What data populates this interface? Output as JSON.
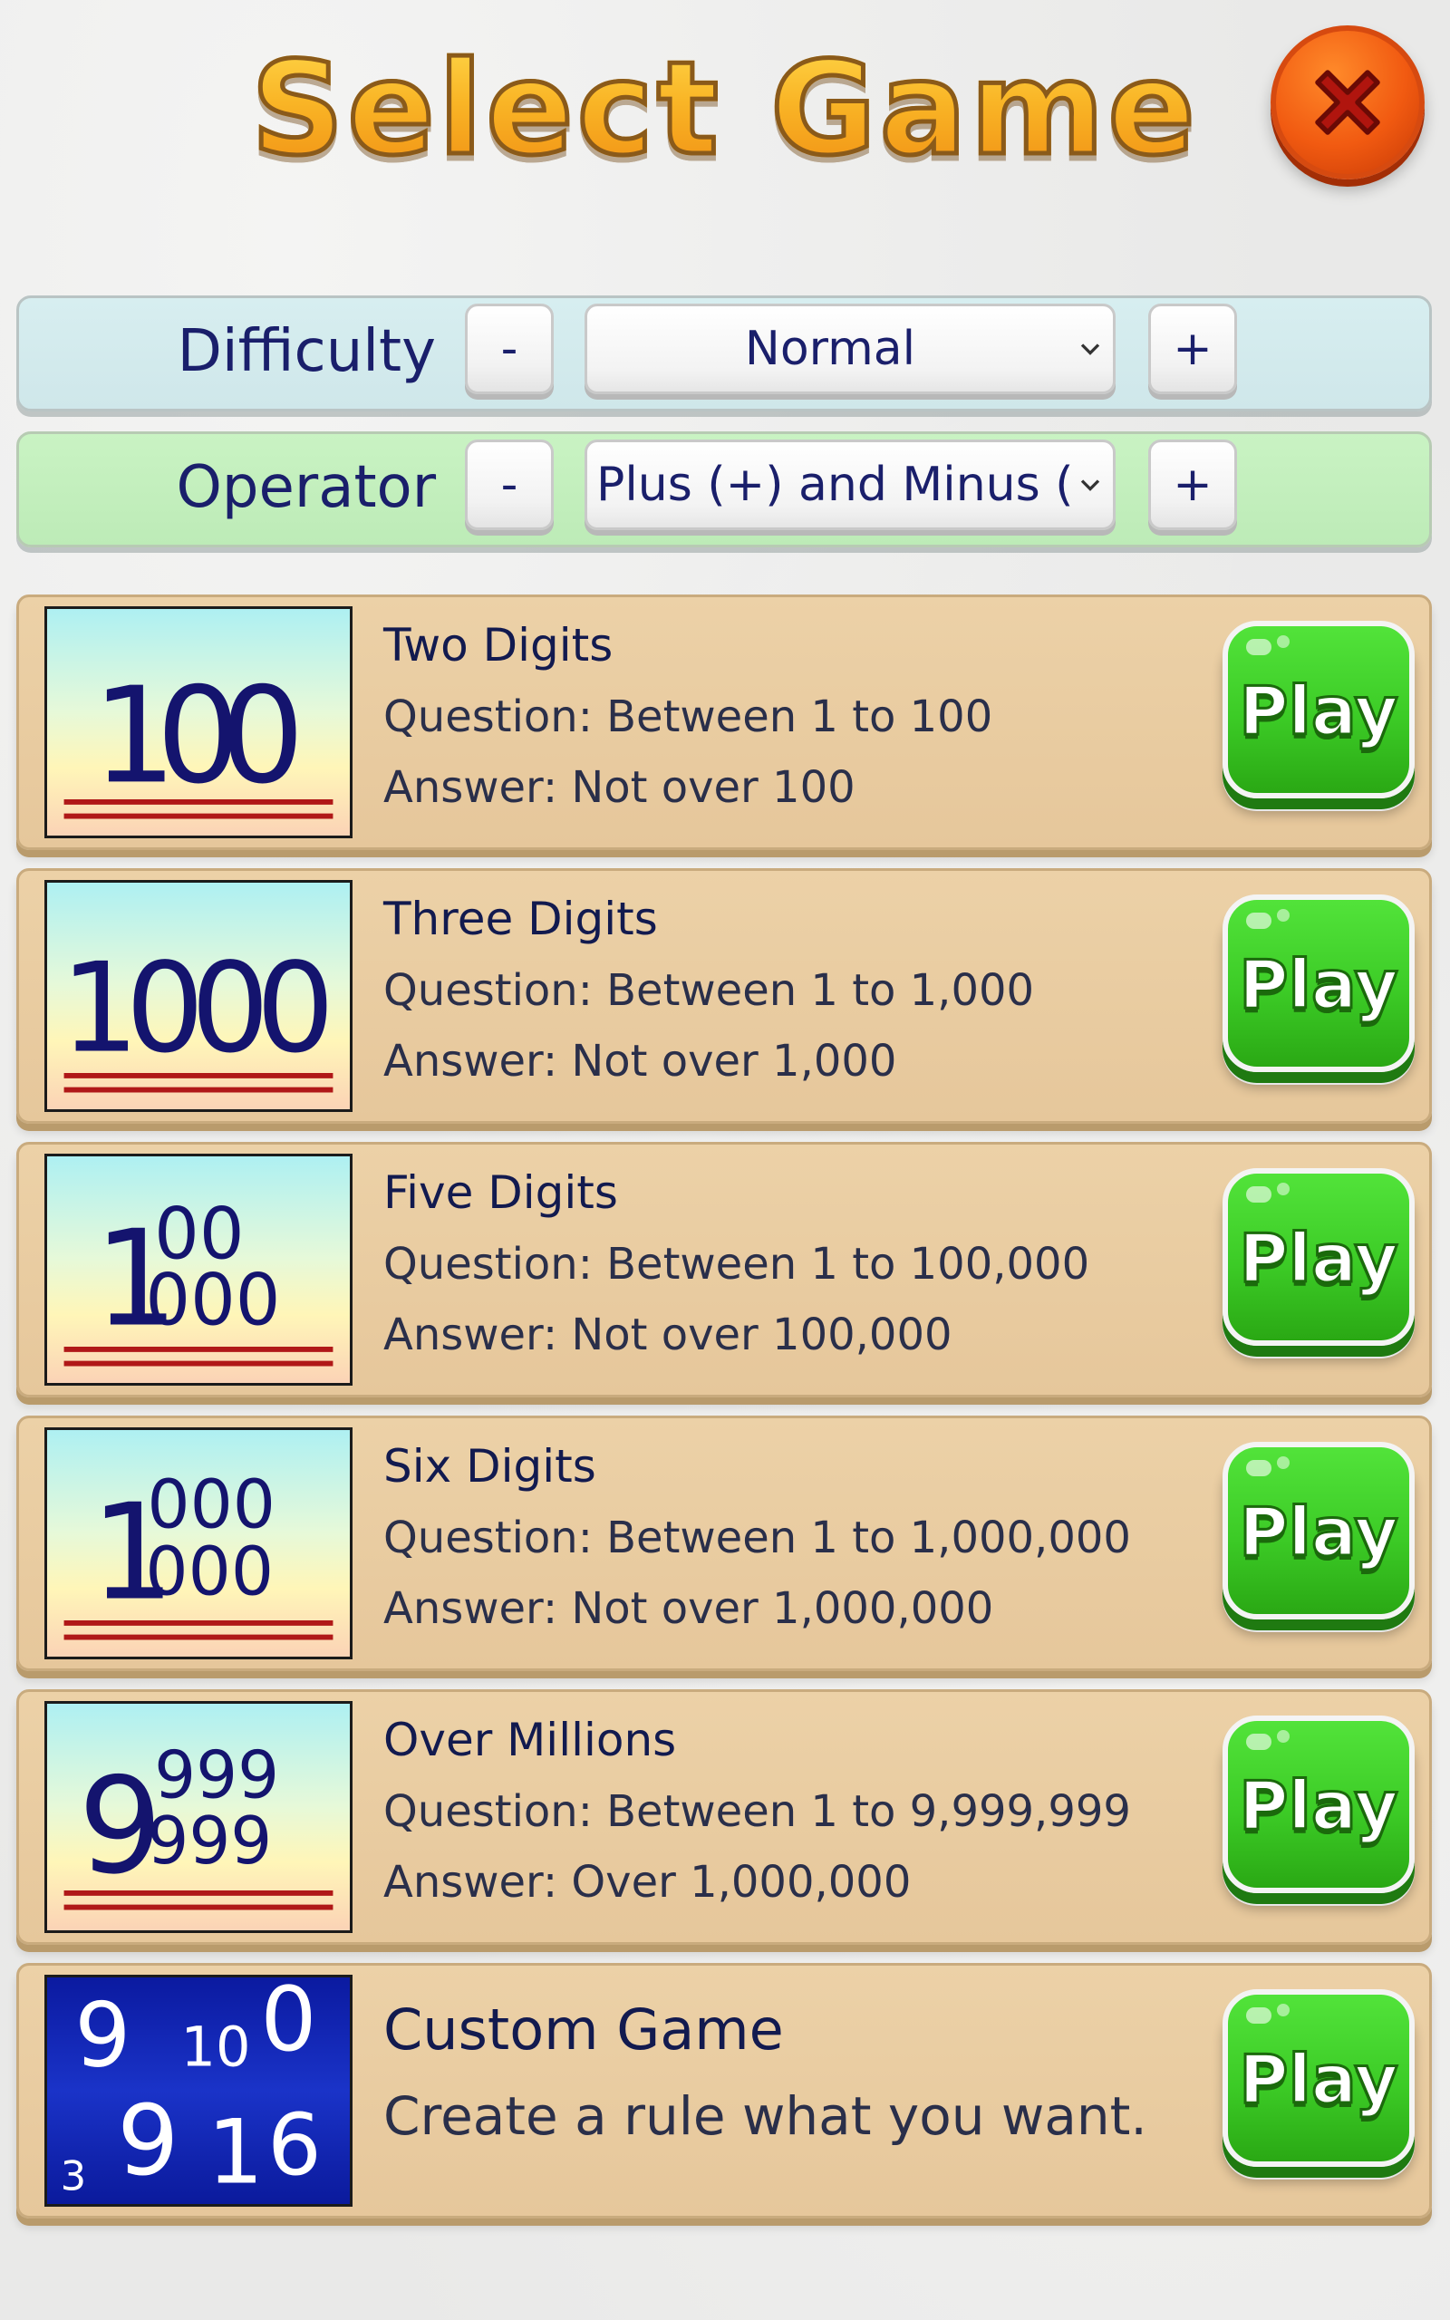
{
  "header": {
    "title": "Select Game"
  },
  "colors": {
    "title": "#f7a51a",
    "close": "#f15a11",
    "play": "#3ccb26",
    "text": "#1a1f6b",
    "card": "#e8cba0"
  },
  "settings": {
    "difficulty": {
      "label": "Difficulty",
      "minus": "-",
      "plus": "+",
      "value": "Normal"
    },
    "operator": {
      "label": "Operator",
      "minus": "-",
      "plus": "+",
      "value": "Plus (+) and Minus (-)"
    }
  },
  "games": [
    {
      "thumb": "100",
      "title": "Two Digits",
      "line1": "Question: Between 1 to 100",
      "line2": "Answer: Not over 100",
      "button": "Play"
    },
    {
      "thumb": "1000",
      "title": "Three Digits",
      "line1": "Question: Between 1 to 1,000",
      "line2": "Answer: Not over 1,000",
      "button": "Play"
    },
    {
      "thumb": "100000",
      "title": "Five Digits",
      "line1": "Question: Between 1 to 100,000",
      "line2": "Answer: Not over 100,000",
      "button": "Play"
    },
    {
      "thumb": "1000000",
      "title": "Six Digits",
      "line1": "Question: Between 1 to 1,000,000",
      "line2": "Answer: Not over 1,000,000",
      "button": "Play"
    },
    {
      "thumb": "9999999",
      "title": "Over Millions",
      "line1": "Question: Between 1 to 9,999,999",
      "line2": "Answer: Over 1,000,000",
      "button": "Play"
    },
    {
      "thumb": "custom",
      "title": "Custom Game",
      "line1": "Create a rule what you want.",
      "button": "Play"
    }
  ],
  "thumbs": {
    "two": {
      "main": "100"
    },
    "three": {
      "main": "1000"
    },
    "five": {
      "lead": "1",
      "top": "00",
      "bottom": "000"
    },
    "six": {
      "lead": "1",
      "top": "000",
      "bottom": "000"
    },
    "millions": {
      "lead": "9",
      "top": "999",
      "bottom": "999"
    },
    "custom": {
      "a": "9",
      "b": "10",
      "c": "0",
      "d": "3",
      "e": "9",
      "f": "1",
      "g": "6"
    }
  },
  "icons": {
    "close": "close-x-icon",
    "dropdown": "chevron-down-icon"
  }
}
